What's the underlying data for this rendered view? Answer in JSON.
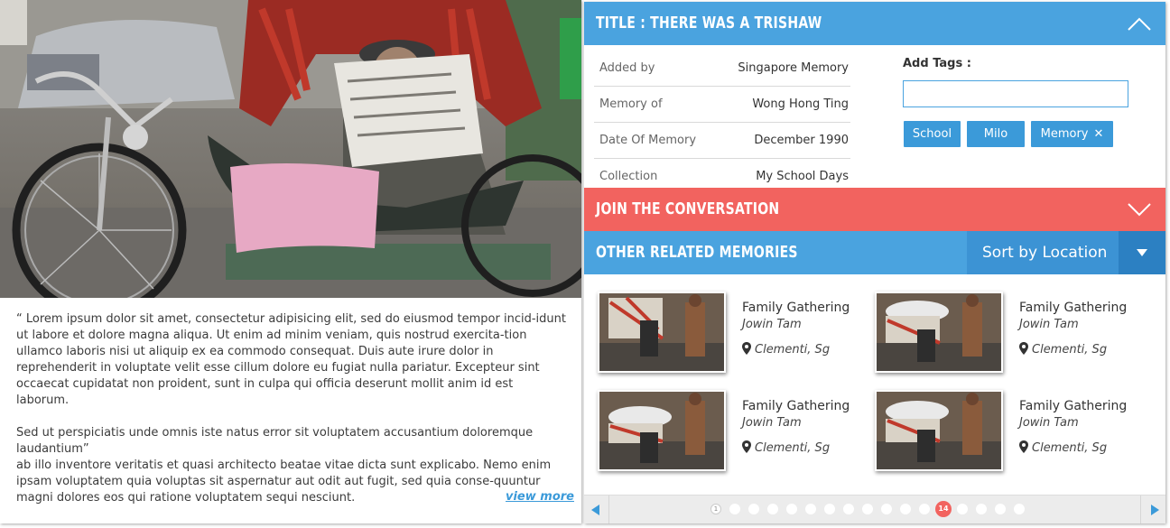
{
  "story": {
    "paragraph1": "“ Lorem ipsum dolor sit amet, consectetur adipisicing elit, sed do eiusmod tempor incid-idunt ut labore et dolore magna aliqua. Ut enim ad minim veniam, quis nostrud exercita-tion ullamco laboris nisi ut aliquip ex ea commodo consequat. Duis aute irure dolor in reprehenderit in voluptate velit esse cillum dolore eu fugiat nulla pariatur. Excepteur sint occaecat cupidatat non proident, sunt in culpa qui officia deserunt mollit anim id est laborum.",
    "paragraph2": "Sed ut perspiciatis unde omnis iste natus error sit voluptatem accusantium doloremque laudantium”",
    "paragraph3": "ab illo inventore veritatis et quasi architecto beatae vitae dicta sunt explicabo. Nemo enim ipsam voluptatem quia voluptas sit aspernatur aut odit aut fugit, sed quia conse-quuntur magni dolores eos qui ratione voluptatem sequi nesciunt.",
    "view_more": "view more"
  },
  "memory": {
    "title": "TITLE : THERE WAS A TRISHAW",
    "details": [
      {
        "label": "Added by",
        "value": "Singapore Memory"
      },
      {
        "label": "Memory of",
        "value": "Wong Hong Ting"
      },
      {
        "label": "Date Of Memory",
        "value": "December 1990"
      },
      {
        "label": "Collection",
        "value": "My School Days"
      }
    ],
    "tags_label": "Add Tags :",
    "tag_input_value": "",
    "tags": [
      {
        "label": "School",
        "removable": false
      },
      {
        "label": "Milo",
        "removable": false
      },
      {
        "label": "Memory",
        "removable": true,
        "remove_glyph": "✕"
      }
    ]
  },
  "join": {
    "title": "JOIN THE CONVERSATION"
  },
  "related": {
    "title": "OTHER RELATED MEMORIES",
    "sort_label": "Sort by Location",
    "items": [
      {
        "title": "Family Gathering",
        "author": "Jowin Tam",
        "location": "Clementi, Sg"
      },
      {
        "title": "Family Gathering",
        "author": "Jowin Tam",
        "location": "Clementi, Sg"
      },
      {
        "title": "Family Gathering",
        "author": "Jowin Tam",
        "location": "Clementi, Sg"
      },
      {
        "title": "Family Gathering",
        "author": "Jowin Tam",
        "location": "Clementi, Sg"
      }
    ]
  },
  "pagination": {
    "first_label": "1",
    "current_label": "14",
    "total_dots": 17,
    "current_index": 12
  },
  "colors": {
    "blue_bar": "#4aa3df",
    "sort_blue": "#3c93d4",
    "coral_bar": "#f2635f",
    "tag_blue": "#3b9ad9",
    "active_dot": "#f2635f"
  },
  "icons": {
    "collapse": "chevron-up-icon",
    "expand": "chevron-down-icon",
    "sort_caret": "caret-down-icon",
    "location": "map-pin-icon",
    "tag_remove": "close-icon",
    "prev": "triangle-left-icon",
    "next": "triangle-right-icon"
  }
}
